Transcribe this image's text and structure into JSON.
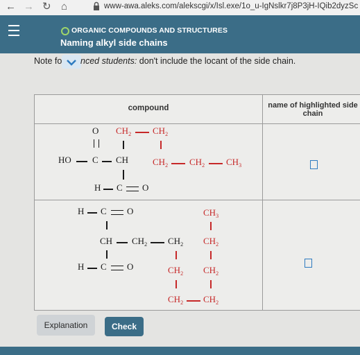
{
  "browser": {
    "url": "www-awa.aleks.com/alekscgi/x/Isl.exe/1o_u-IgNslkr7j8P3jH-IQib2dyzSc"
  },
  "header": {
    "topic": "ORGANIC COMPOUNDS AND STRUCTURES",
    "lesson": "Naming alkyl side chains"
  },
  "note": {
    "prefix": "Note fo",
    "suffix_italic": "nced students:",
    "suffix_rest": " don't include the locant of the side chain."
  },
  "table": {
    "col_compound": "compound",
    "col_name": "name of highlighted side chain",
    "rows": [
      {
        "labels": {
          "o_top": "O",
          "ho": "HO",
          "c": "C",
          "ch": "CH",
          "ch2_a": "CH",
          "ch2_b": "CH",
          "ch2_c": "CH",
          "ch2_d": "CH",
          "ch3": "CH",
          "h": "H",
          "c_bottom": "C",
          "o_bottom": "O",
          "sub2": "2",
          "sub3": "3"
        },
        "answer": ""
      },
      {
        "labels": {
          "h_top": "H",
          "c_top": "C",
          "o_top": "O",
          "ch": "CH",
          "ch2_a": "CH",
          "ch2_b": "CH",
          "h_bot": "H",
          "c_bot": "C",
          "o_bot": "O",
          "ch3": "CH",
          "ch2_r1": "CH",
          "ch2_r2": "CH",
          "ch2_r3": "CH",
          "ch2_l": "CH",
          "ch2_l2": "CH",
          "sub2": "2",
          "sub3": "3"
        },
        "answer": ""
      }
    ]
  },
  "buttons": {
    "explanation": "Explanation",
    "check": "Check"
  },
  "colors": {
    "header_bg": "#3b6d87",
    "highlight": "#c62828",
    "answer_box": "#2e7bc0"
  }
}
